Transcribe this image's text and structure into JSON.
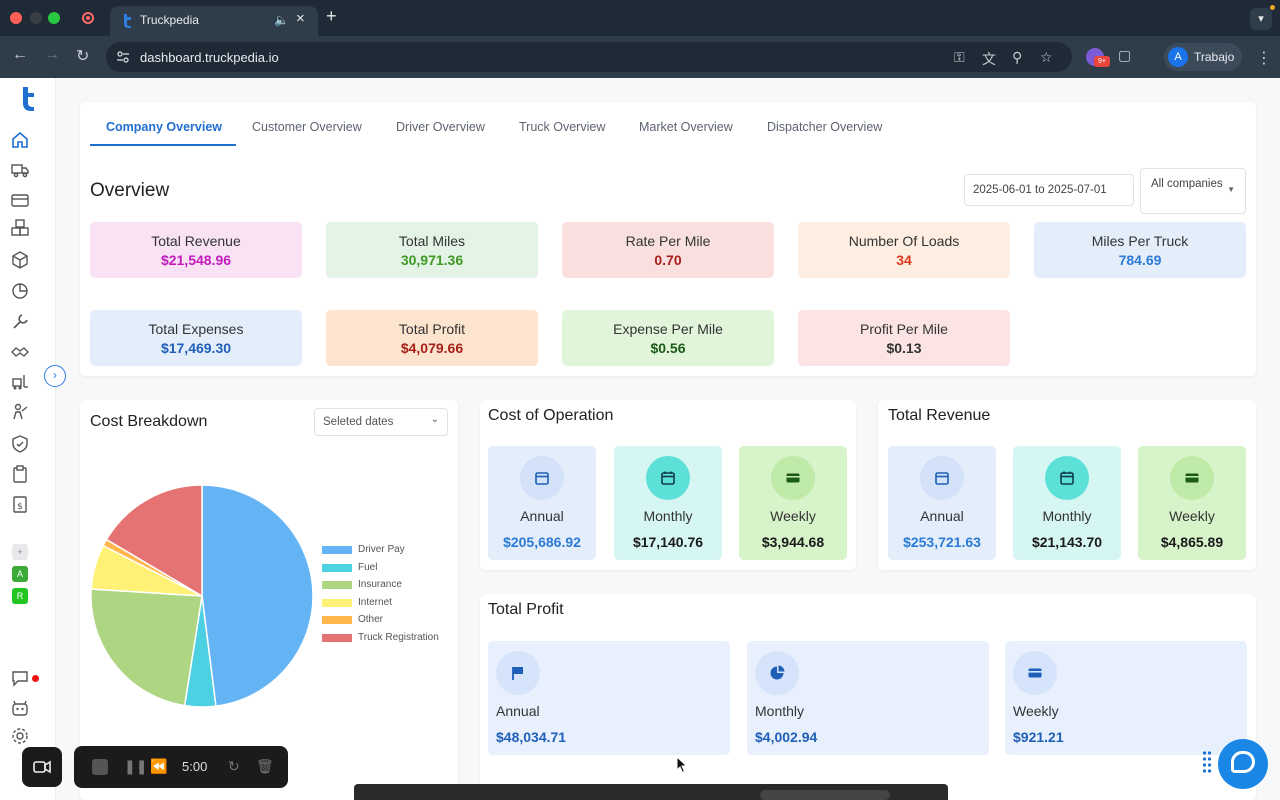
{
  "browser": {
    "tab_title": "Truckpedia",
    "tab_audio_icon": "speaker-icon",
    "url": "dashboard.truckpedia.io",
    "profile_initial": "A",
    "profile_name": "Trabajo",
    "extension_badge": "9+"
  },
  "tabs": [
    {
      "label": "Company Overview",
      "active": true
    },
    {
      "label": "Customer Overview",
      "active": false
    },
    {
      "label": "Driver Overview",
      "active": false
    },
    {
      "label": "Truck Overview",
      "active": false
    },
    {
      "label": "Market Overview",
      "active": false
    },
    {
      "label": "Dispatcher Overview",
      "active": false
    }
  ],
  "overview": {
    "title": "Overview",
    "date_range": "2025-06-01 to 2025-07-01",
    "company_filter": "All companies",
    "stats": [
      {
        "label": "Total Revenue",
        "value": "$21,548.96",
        "color": "#c21bbd",
        "bg": "#f8e2f4"
      },
      {
        "label": "Total Miles",
        "value": "30,971.36",
        "color": "#3f9a23",
        "bg": "#e3f3e6"
      },
      {
        "label": "Rate Per Mile",
        "value": "0.70",
        "color": "#a8201a",
        "bg": "#f9e0df"
      },
      {
        "label": "Number Of Loads",
        "value": "34",
        "color": "#d9381a",
        "bg": "#fdeee1"
      },
      {
        "label": "Miles Per Truck",
        "value": "784.69",
        "color": "#2b7ad6",
        "bg": "#e4eefb"
      },
      {
        "label": "Total Expenses",
        "value": "$17,469.30",
        "color": "#1f5fb8",
        "bg": "#e4eefb"
      },
      {
        "label": "Total Profit",
        "value": "$4,079.66",
        "color": "#a8201a",
        "bg": "#fce4cf"
      },
      {
        "label": "Expense Per Mile",
        "value": "$0.56",
        "color": "#1c5a18",
        "bg": "#e0f5d9"
      },
      {
        "label": "Profit Per Mile",
        "value": "$0.13",
        "color": "#333333",
        "bg": "#fbe4e3"
      }
    ]
  },
  "cost_breakdown": {
    "title": "Cost Breakdown",
    "date_select": "Seleted dates"
  },
  "chart_data": {
    "type": "pie",
    "categories": [
      "Driver Pay",
      "Fuel",
      "Insurance",
      "Internet",
      "Other",
      "Truck Registration"
    ],
    "values": [
      48.0,
      4.5,
      23.5,
      6.5,
      1.0,
      16.5
    ],
    "colors": [
      "#64b3f4",
      "#4dd0e1",
      "#aed581",
      "#fff176",
      "#ffb74d",
      "#e57373"
    ],
    "legend": "right"
  },
  "cost_of_operation": {
    "title": "Cost of Operation",
    "items": [
      {
        "label": "Annual",
        "value": "$205,686.92",
        "icon": "calendar-icon",
        "color": "#2b7ad6",
        "bg": "#e4eefb",
        "icon_bg": "#d3e2f8"
      },
      {
        "label": "Monthly",
        "value": "$17,140.76",
        "icon": "calendar-icon",
        "color": "#1a1a1a",
        "bg": "#d5f6f2",
        "icon_bg": "#5de0d8"
      },
      {
        "label": "Weekly",
        "value": "$3,944.68",
        "icon": "card-icon",
        "color": "#1a1a1a",
        "bg": "#d7f3c9",
        "icon_bg": "#bfeaa8"
      }
    ]
  },
  "total_revenue": {
    "title": "Total Revenue",
    "items": [
      {
        "label": "Annual",
        "value": "$253,721.63",
        "icon": "calendar-icon",
        "color": "#2b7ad6",
        "bg": "#e4eefb",
        "icon_bg": "#d3e2f8"
      },
      {
        "label": "Monthly",
        "value": "$21,143.70",
        "icon": "calendar-icon",
        "color": "#1a1a1a",
        "bg": "#d5f6f2",
        "icon_bg": "#5de0d8"
      },
      {
        "label": "Weekly",
        "value": "$4,865.89",
        "icon": "card-icon",
        "color": "#1a1a1a",
        "bg": "#d7f3c9",
        "icon_bg": "#bfeaa8"
      }
    ]
  },
  "total_profit": {
    "title": "Total Profit",
    "items": [
      {
        "label": "Annual",
        "value": "$48,034.71",
        "icon": "flag-icon"
      },
      {
        "label": "Monthly",
        "value": "$4,002.94",
        "icon": "pie-chart-icon"
      },
      {
        "label": "Weekly",
        "value": "$921.21",
        "icon": "card-icon"
      }
    ]
  },
  "sidebar": {
    "badges": [
      {
        "label": "+",
        "color": "#cfd3d8"
      },
      {
        "label": "A",
        "color": "#3aa935"
      },
      {
        "label": "R",
        "color": "#22c41e"
      }
    ]
  },
  "recorder": {
    "time": "5:00"
  }
}
